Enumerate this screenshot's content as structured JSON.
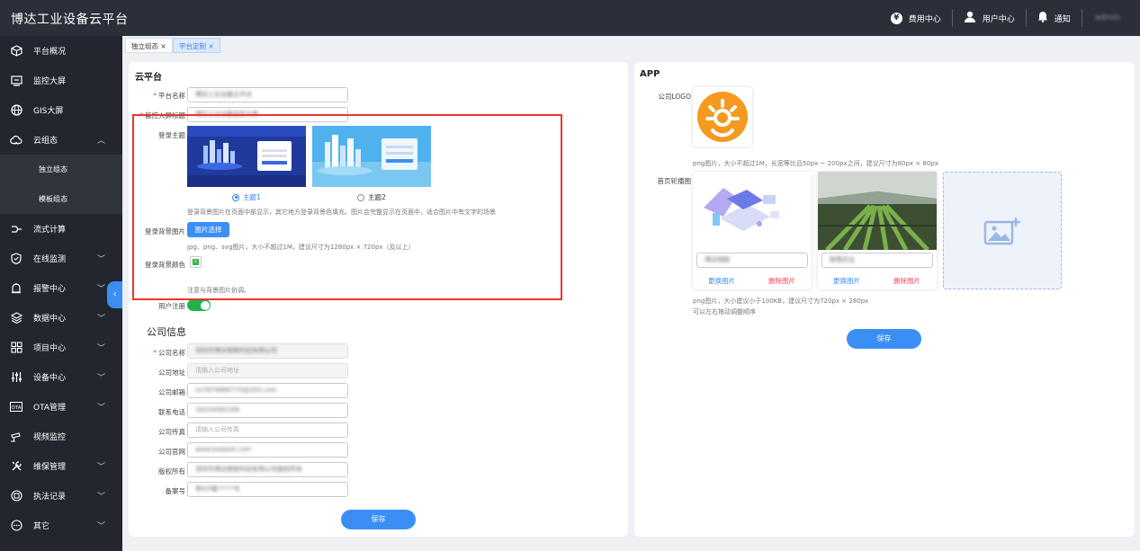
{
  "app": {
    "title": "博达工业设备云平台"
  },
  "topbar": {
    "fee_label": "费用中心",
    "fee_icon": "¥",
    "user_label": "用户中心",
    "notice_label": "通知",
    "username": "admin"
  },
  "sidebar": {
    "items": [
      {
        "label": "平台概况",
        "icon": "cube-icon"
      },
      {
        "label": "监控大屏",
        "icon": "screen-icon"
      },
      {
        "label": "GIS大屏",
        "icon": "globe-icon"
      },
      {
        "label": "云组态",
        "icon": "cloud-icon"
      },
      {
        "label": "独立组态"
      },
      {
        "label": "模板组态"
      },
      {
        "label": "流式计算",
        "icon": "flow-icon"
      },
      {
        "label": "在线监测",
        "icon": "shield-icon"
      },
      {
        "label": "报警中心",
        "icon": "alarm-icon"
      },
      {
        "label": "数据中心",
        "icon": "layers-icon"
      },
      {
        "label": "项目中心",
        "icon": "grid-icon"
      },
      {
        "label": "设备中心",
        "icon": "sliders-icon"
      },
      {
        "label": "OTA管理",
        "icon": "ota-icon"
      },
      {
        "label": "视频监控",
        "icon": "camera-icon"
      },
      {
        "label": "维保管理",
        "icon": "tools-icon"
      },
      {
        "label": "执法记录",
        "icon": "record-icon"
      },
      {
        "label": "其它",
        "icon": "more-icon"
      }
    ]
  },
  "tabs": [
    {
      "label": "独立组态 ×"
    },
    {
      "label": "平台定制 ×"
    }
  ],
  "cloud": {
    "title": "云平台",
    "platform_name_label": "平台名称",
    "platform_name_value": "博达工业设备云平台",
    "screen_title_label": "监控大屏标题",
    "screen_title_value": "博达工业设备监控大屏",
    "theme_label": "登录主题",
    "theme1": "主题1",
    "theme2": "主题2",
    "theme_hint": "登录背景图片在页面中部显示，其它地方登录背景色填充。图片会完整显示在页面中，适合图片中有文字的场景",
    "bg_image_label": "登录背景图片",
    "bg_image_button": "图片选择",
    "bg_image_hint": "jpg、png、svg图片，大小不超过1M，建议尺寸为1280px × 720px（及以上）",
    "bg_color_label": "登录背景颜色",
    "bg_color_hint": "注意与背景图片协调。",
    "register_label": "用户注册",
    "register_on": true
  },
  "company": {
    "title": "公司信息",
    "name_label": "公司名称",
    "name_value": "深圳市博达智联科技有限公司",
    "address_label": "公司地址",
    "address_placeholder": "请输入公司地址",
    "email_label": "公司邮箱",
    "email_value": "xx7874666775@163.com",
    "phone_label": "联系电话",
    "phone_value": "18334582189",
    "fax_label": "公司传真",
    "fax_placeholder": "请输入公司传真",
    "website_label": "公司官网",
    "website_value": "www.bodaiot.com",
    "copyright_label": "版权所有",
    "copyright_value": "深圳市博达智联科技有限公司版权所有",
    "icp_label": "备案号",
    "icp_value": "粤ICP备*****号",
    "save_label": "保存"
  },
  "app_panel": {
    "title": "APP",
    "logo_label": "公司LOGO",
    "logo_hint": "png图片，大小不超过1M，长宽等比且50px ~ 200px之间，建议尺寸为80px × 80px",
    "carousel_label": "首页轮播图",
    "slides": [
      {
        "caption": "博达物联",
        "replace": "更换图片",
        "delete": "删除图片"
      },
      {
        "caption": "智慧农业",
        "replace": "更换图片",
        "delete": "删除图片"
      }
    ],
    "carousel_hint1": "png图片，大小建议小于100KB，建议尺寸为720px × 280px",
    "carousel_hint2": "可以左右拖动调整顺序",
    "save_label": "保存"
  },
  "colors": {
    "primary": "#3b8ff4",
    "sidebar": "#23262e",
    "topbar": "#2b2f3a",
    "highlight": "#e8382a",
    "toggle": "#22b24c"
  }
}
